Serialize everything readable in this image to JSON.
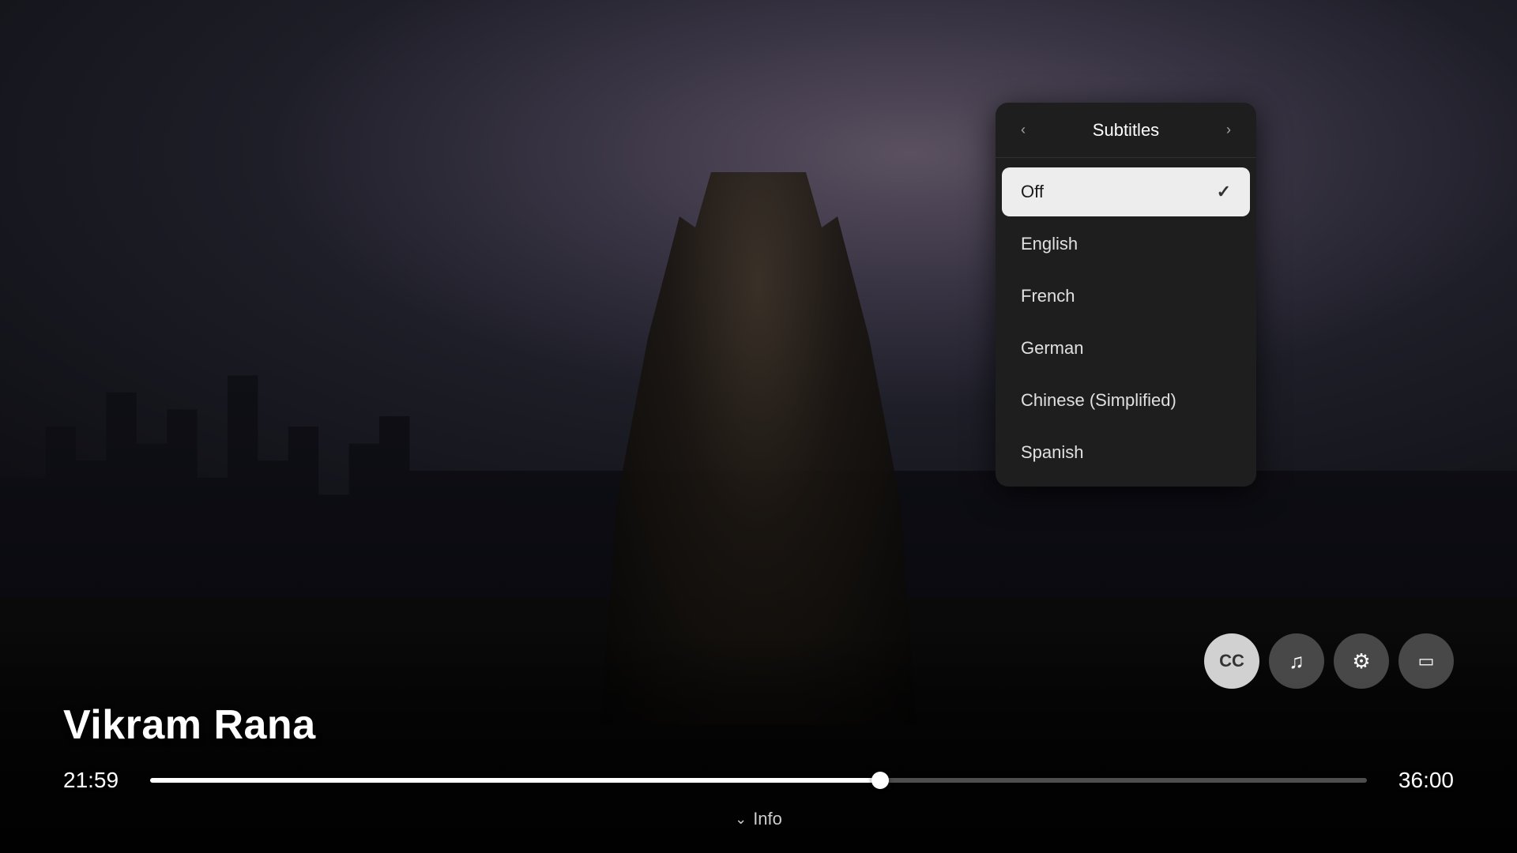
{
  "video": {
    "title": "Vikram Rana",
    "current_time": "21:59",
    "total_time": "36:00",
    "progress_percent": 60
  },
  "subtitles_panel": {
    "title": "Subtitles",
    "nav_prev": "‹",
    "nav_next": "›",
    "items": [
      {
        "id": "off",
        "label": "Off",
        "selected": true
      },
      {
        "id": "english",
        "label": "English",
        "selected": false
      },
      {
        "id": "french",
        "label": "French",
        "selected": false
      },
      {
        "id": "german",
        "label": "German",
        "selected": false
      },
      {
        "id": "chinese-simplified",
        "label": "Chinese (Simplified)",
        "selected": false
      },
      {
        "id": "spanish",
        "label": "Spanish",
        "selected": false
      }
    ]
  },
  "controls": {
    "subtitle_icon": "⊡",
    "music_icon": "♪",
    "settings_icon": "⚙",
    "pip_icon": "⧉",
    "info_label": "Info",
    "chevron_down": "∨"
  }
}
